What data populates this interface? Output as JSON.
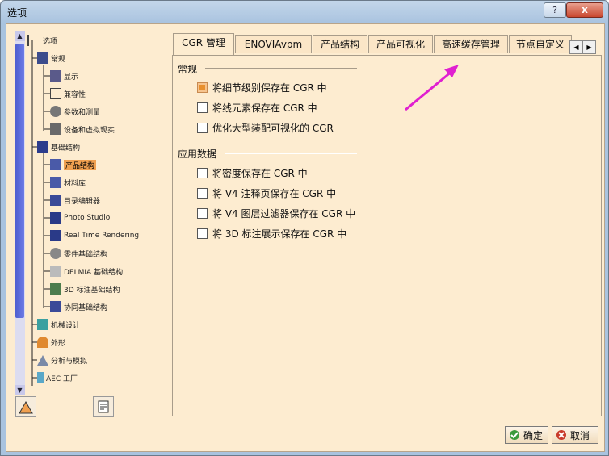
{
  "window": {
    "title": "选项",
    "help_label": "?",
    "close_label": "x"
  },
  "tree": {
    "nodes": [
      {
        "label": "选项"
      },
      {
        "label": "常规"
      },
      {
        "label": "显示"
      },
      {
        "label": "兼容性"
      },
      {
        "label": "参数和测量"
      },
      {
        "label": "设备和虚拟现实"
      },
      {
        "label": "基础结构"
      },
      {
        "label": "产品结构"
      },
      {
        "label": "材料库"
      },
      {
        "label": "目录编辑器"
      },
      {
        "label": "Photo Studio"
      },
      {
        "label": "Real Time Rendering"
      },
      {
        "label": "零件基础结构"
      },
      {
        "label": "DELMIA 基础结构"
      },
      {
        "label": "3D 标注基础结构"
      },
      {
        "label": "协同基础结构"
      },
      {
        "label": "机械设计"
      },
      {
        "label": "外形"
      },
      {
        "label": "分析与模拟"
      },
      {
        "label": "AEC 工厂"
      }
    ]
  },
  "tabs": [
    {
      "label": "CGR 管理"
    },
    {
      "label": "ENOVIAvpm"
    },
    {
      "label": "产品结构"
    },
    {
      "label": "产品可视化"
    },
    {
      "label": "高速缓存管理"
    },
    {
      "label": "节点自定义"
    }
  ],
  "groups": {
    "general": {
      "title": "常规",
      "options": [
        {
          "label": "将细节级别保存在 CGR 中",
          "checked": true
        },
        {
          "label": "将线元素保存在 CGR 中",
          "checked": false
        },
        {
          "label": "优化大型装配可视化的 CGR",
          "checked": false
        }
      ]
    },
    "app_data": {
      "title": "应用数据",
      "options": [
        {
          "label": "将密度保存在 CGR 中",
          "checked": false
        },
        {
          "label": "将 V4 注释页保存在 CGR 中",
          "checked": false
        },
        {
          "label": "将 V4 图层过滤器保存在 CGR 中",
          "checked": false
        },
        {
          "label": "将 3D 标注展示保存在 CGR 中",
          "checked": false
        }
      ]
    }
  },
  "buttons": {
    "ok": "确定",
    "cancel": "取消"
  },
  "colors": {
    "panel_bg": "#fdecd0",
    "selection": "#f0a050",
    "annotation_arrow": "#e020d0"
  }
}
